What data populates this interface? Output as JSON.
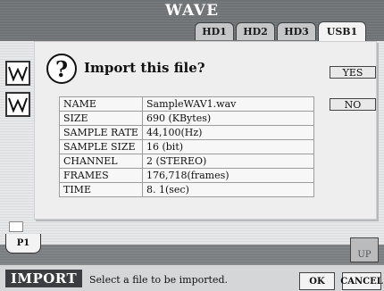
{
  "window": {
    "title": "WAVE"
  },
  "tabs": [
    {
      "label": "HD1"
    },
    {
      "label": "HD2"
    },
    {
      "label": "HD3"
    },
    {
      "label": "USB1"
    }
  ],
  "dialog": {
    "question": "Import this file?",
    "yes_label": "YES",
    "no_label": "NO",
    "info": [
      {
        "key": "NAME",
        "value": "SampleWAV1.wav"
      },
      {
        "key": "SIZE",
        "value": "690 (KBytes)"
      },
      {
        "key": "SAMPLE RATE",
        "value": "44,100(Hz)"
      },
      {
        "key": "SAMPLE SIZE",
        "value": "16 (bit)"
      },
      {
        "key": "CHANNEL",
        "value": "2 (STEREO)"
      },
      {
        "key": "FRAMES",
        "value": "176,718(frames)"
      },
      {
        "key": "TIME",
        "value": "8. 1(sec)"
      }
    ]
  },
  "page_tab": {
    "label": "P1"
  },
  "up_label": "UP",
  "bottom": {
    "mode_label": "IMPORT",
    "status_text": "Select a file to be imported.",
    "ok_label": "OK",
    "cancel_label": "CANCEL"
  },
  "icons": {
    "question": "?"
  }
}
